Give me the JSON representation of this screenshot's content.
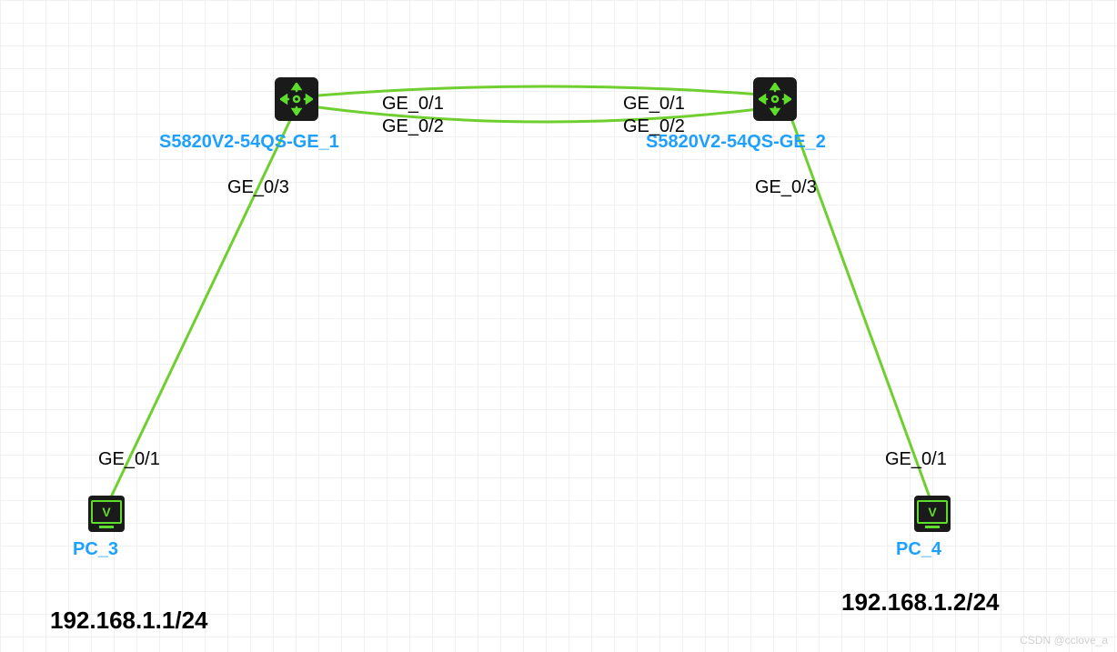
{
  "watermark": "CSDN @cclove_a",
  "devices": {
    "switch1": {
      "label": "S5820V2-54QS-GE_1"
    },
    "switch2": {
      "label": "S5820V2-54QS-GE_2"
    },
    "pc3": {
      "label": "PC_3",
      "ip": "192.168.1.1/24"
    },
    "pc4": {
      "label": "PC_4",
      "ip": "192.168.1.2/24"
    }
  },
  "ports": {
    "sw1_ge01": "GE_0/1",
    "sw1_ge02": "GE_0/2",
    "sw1_ge03": "GE_0/3",
    "sw2_ge01": "GE_0/1",
    "sw2_ge02": "GE_0/2",
    "sw2_ge03": "GE_0/3",
    "pc3_ge01": "GE_0/1",
    "pc4_ge01": "GE_0/1"
  },
  "pc_glyph": "V",
  "colors": {
    "link": "#6ecf2f",
    "label": "#1ea0ff",
    "icon_bg": "#1a1a1a",
    "icon_fg": "#5edd2d"
  }
}
